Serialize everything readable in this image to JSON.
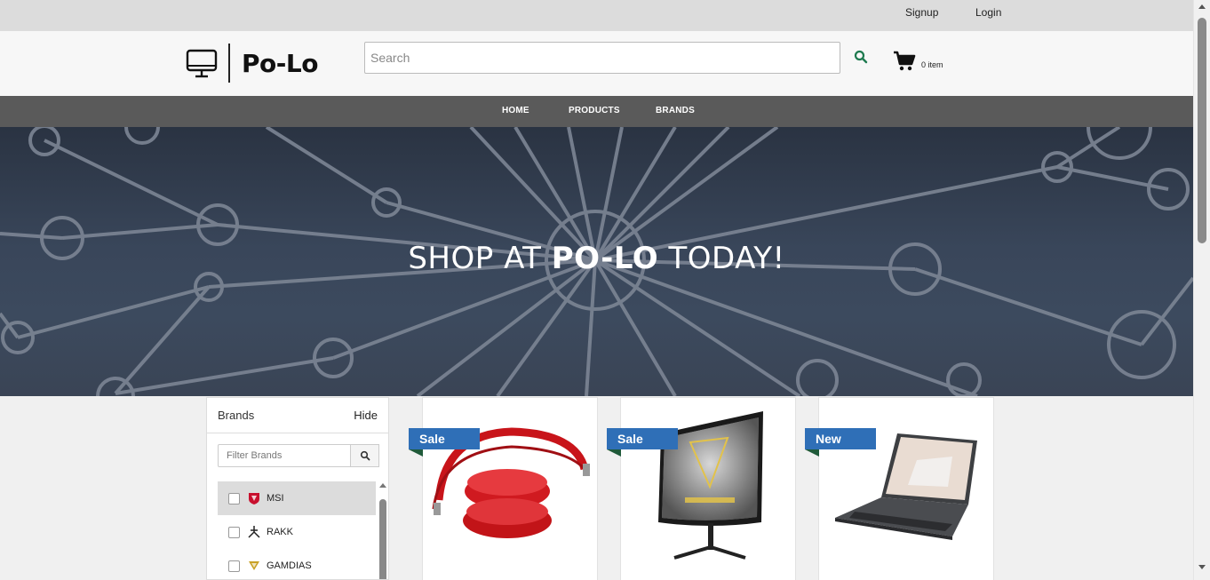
{
  "topbar": {
    "signup_label": "Signup",
    "login_label": "Login"
  },
  "header": {
    "logo_text": "Po-Lo",
    "search_placeholder": "Search",
    "cart_count_text": "0 item"
  },
  "nav": {
    "items": [
      {
        "label": "HOME"
      },
      {
        "label": "PRODUCTS"
      },
      {
        "label": "BRANDS"
      }
    ]
  },
  "hero": {
    "title_pre": "SHOP AT ",
    "title_brand": "PO-LO",
    "title_post": " TODAY!"
  },
  "brands_panel": {
    "title": "Brands",
    "hide_label": "Hide",
    "filter_placeholder": "Filter Brands",
    "items": [
      {
        "name": "MSI",
        "icon": "msi-dragon-icon",
        "checked": false,
        "highlighted": true
      },
      {
        "name": "RAKK",
        "icon": "rakk-logo-icon",
        "checked": false,
        "highlighted": false
      },
      {
        "name": "GAMDIAS",
        "icon": "gamdias-logo-icon",
        "checked": false,
        "highlighted": false
      }
    ]
  },
  "products": [
    {
      "badge": "Sale",
      "image": "red-headphones"
    },
    {
      "badge": "Sale",
      "image": "gamdias-curved-monitor"
    },
    {
      "badge": "New",
      "image": "msi-laptop"
    }
  ],
  "colors": {
    "accent_badge": "#2f6fb7",
    "search_icon": "#1e7a4f",
    "nav_bg": "#5a5a5a",
    "topbar_bg": "#dcdcdc"
  }
}
